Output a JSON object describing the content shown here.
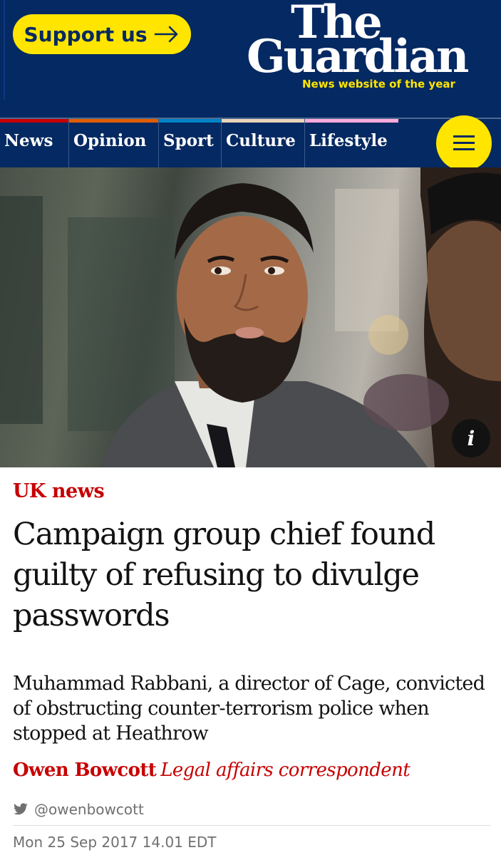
{
  "header": {
    "support_label": "Support us",
    "logo_line1": "The",
    "logo_line2": "Guardian",
    "tagline": "News website of the year"
  },
  "nav": {
    "items": [
      {
        "label": "News",
        "color": "#c70000"
      },
      {
        "label": "Opinion",
        "color": "#e05e00"
      },
      {
        "label": "Sport",
        "color": "#0084c6"
      },
      {
        "label": "Culture",
        "color": "#a1845c"
      },
      {
        "label": "Lifestyle",
        "color": "#bb3b80"
      }
    ]
  },
  "hero": {
    "info_label": "i"
  },
  "article": {
    "section": "UK news",
    "headline": "Campaign group chief found guilty of refusing to divulge passwords",
    "standfirst": "Muhammad Rabbani, a director of Cage, convicted of obstructing counter-terrorism police when stopped at Heathrow",
    "author": "Owen Bowcott",
    "role": "Legal affairs correspondent",
    "twitter_handle": "@owenbowcott",
    "date": "Mon 25 Sep 2017 14.01 EDT"
  },
  "colors": {
    "brand_blue": "#052962",
    "accent_yellow": "#ffe500",
    "news_red": "#c70000"
  }
}
